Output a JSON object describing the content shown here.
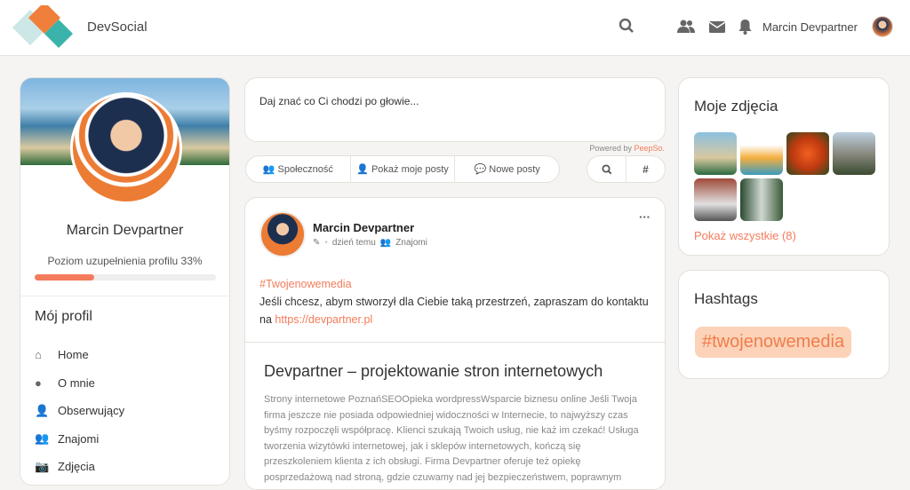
{
  "header": {
    "brand": "DevSocial",
    "user_name": "Marcin Devpartner"
  },
  "profile": {
    "name": "Marcin Devpartner",
    "completion_label": "Poziom uzupełnienia profilu 33%",
    "completion_percent": 33,
    "menu_title": "Mój profil",
    "menu": [
      {
        "label": "Home",
        "icon": "home-icon",
        "glyph": "⌂"
      },
      {
        "label": "O mnie",
        "icon": "user-circle-icon",
        "glyph": "●"
      },
      {
        "label": "Obserwujący",
        "icon": "user-check-icon",
        "glyph": "👤"
      },
      {
        "label": "Znajomi",
        "icon": "users-icon",
        "glyph": "👥"
      },
      {
        "label": "Zdjęcia",
        "icon": "camera-icon",
        "glyph": "📷"
      }
    ]
  },
  "composer": {
    "placeholder": "Daj znać co Ci chodzi po głowie...",
    "powered_by": "Powered by ",
    "powered_brand": "PeepSo",
    "powered_dot": "."
  },
  "filters": {
    "community": "Społeczność",
    "my_posts": "Pokaż moje posty",
    "new_posts": "Nowe posty"
  },
  "post": {
    "author": "Marcin Devpartner",
    "time": "dzień temu",
    "privacy": "Znajomi",
    "hashtag": "#Twojenowemedia",
    "text": "Jeśli chcesz, abym stworzył dla Ciebie taką przestrzeń, zapraszam do kontaktu na ",
    "link": "https://devpartner.pl",
    "preview_title": "Devpartner – projektowanie stron internetowych",
    "preview_text": "Strony internetowe PoznańSEOOpieka wordpressWsparcie biznesu online Jeśli Twoja firma jeszcze nie posiada odpowiedniej widoczności w Internecie, to najwyższy czas byśmy rozpoczęli współpracę. Klienci szukają Twoich usług, nie każ im czekać! Usługa tworzenia wizytówki internetowej, jak i sklepów internetowych, kończą się przeszkoleniem klienta z ich obsługi. Firma Devpartner oferuje też opiekę posprzedażową nad stroną, gdzie czuwamy nad jej bezpieczeństwem, poprawnym"
  },
  "photos": {
    "title": "Moje zdjęcia",
    "show_all": "Pokaż wszystkie (8)"
  },
  "hashtags": {
    "title": "Hashtags",
    "items": [
      "#twojenowemedia"
    ]
  },
  "colors": {
    "accent": "#f47c5c"
  }
}
